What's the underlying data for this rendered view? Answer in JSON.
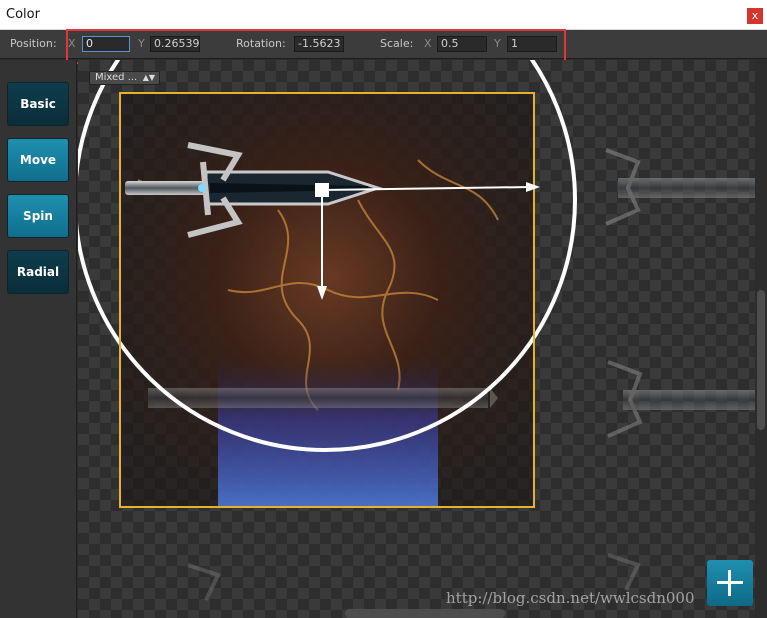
{
  "window": {
    "title": "Color",
    "close_label": "x"
  },
  "toolbar": {
    "position_label": "Position:",
    "x_label": "X",
    "x_value": "0",
    "y_label": "Y",
    "y_value": "0.26539",
    "rotation_label": "Rotation:",
    "rotation_value": "-1.5623",
    "scale_label": "Scale:",
    "scale_x_label": "X",
    "scale_x_value": "0.5",
    "scale_y_label": "Y",
    "scale_y_value": "1"
  },
  "dropdown": {
    "selected": "Mixed ..."
  },
  "sidebar": {
    "items": [
      {
        "label": "Basic",
        "style": "dark"
      },
      {
        "label": "Move",
        "style": "cyan"
      },
      {
        "label": "Spin",
        "style": "cyan"
      },
      {
        "label": "Radial",
        "style": "dark"
      }
    ]
  },
  "fab": {
    "icon": "plus-icon"
  },
  "watermark": "http://blog.csdn.net/wwlcsdn000",
  "colors": {
    "accent": "#1f8fb0",
    "selection": "#e8b12a",
    "highlight": "#e0373c"
  }
}
